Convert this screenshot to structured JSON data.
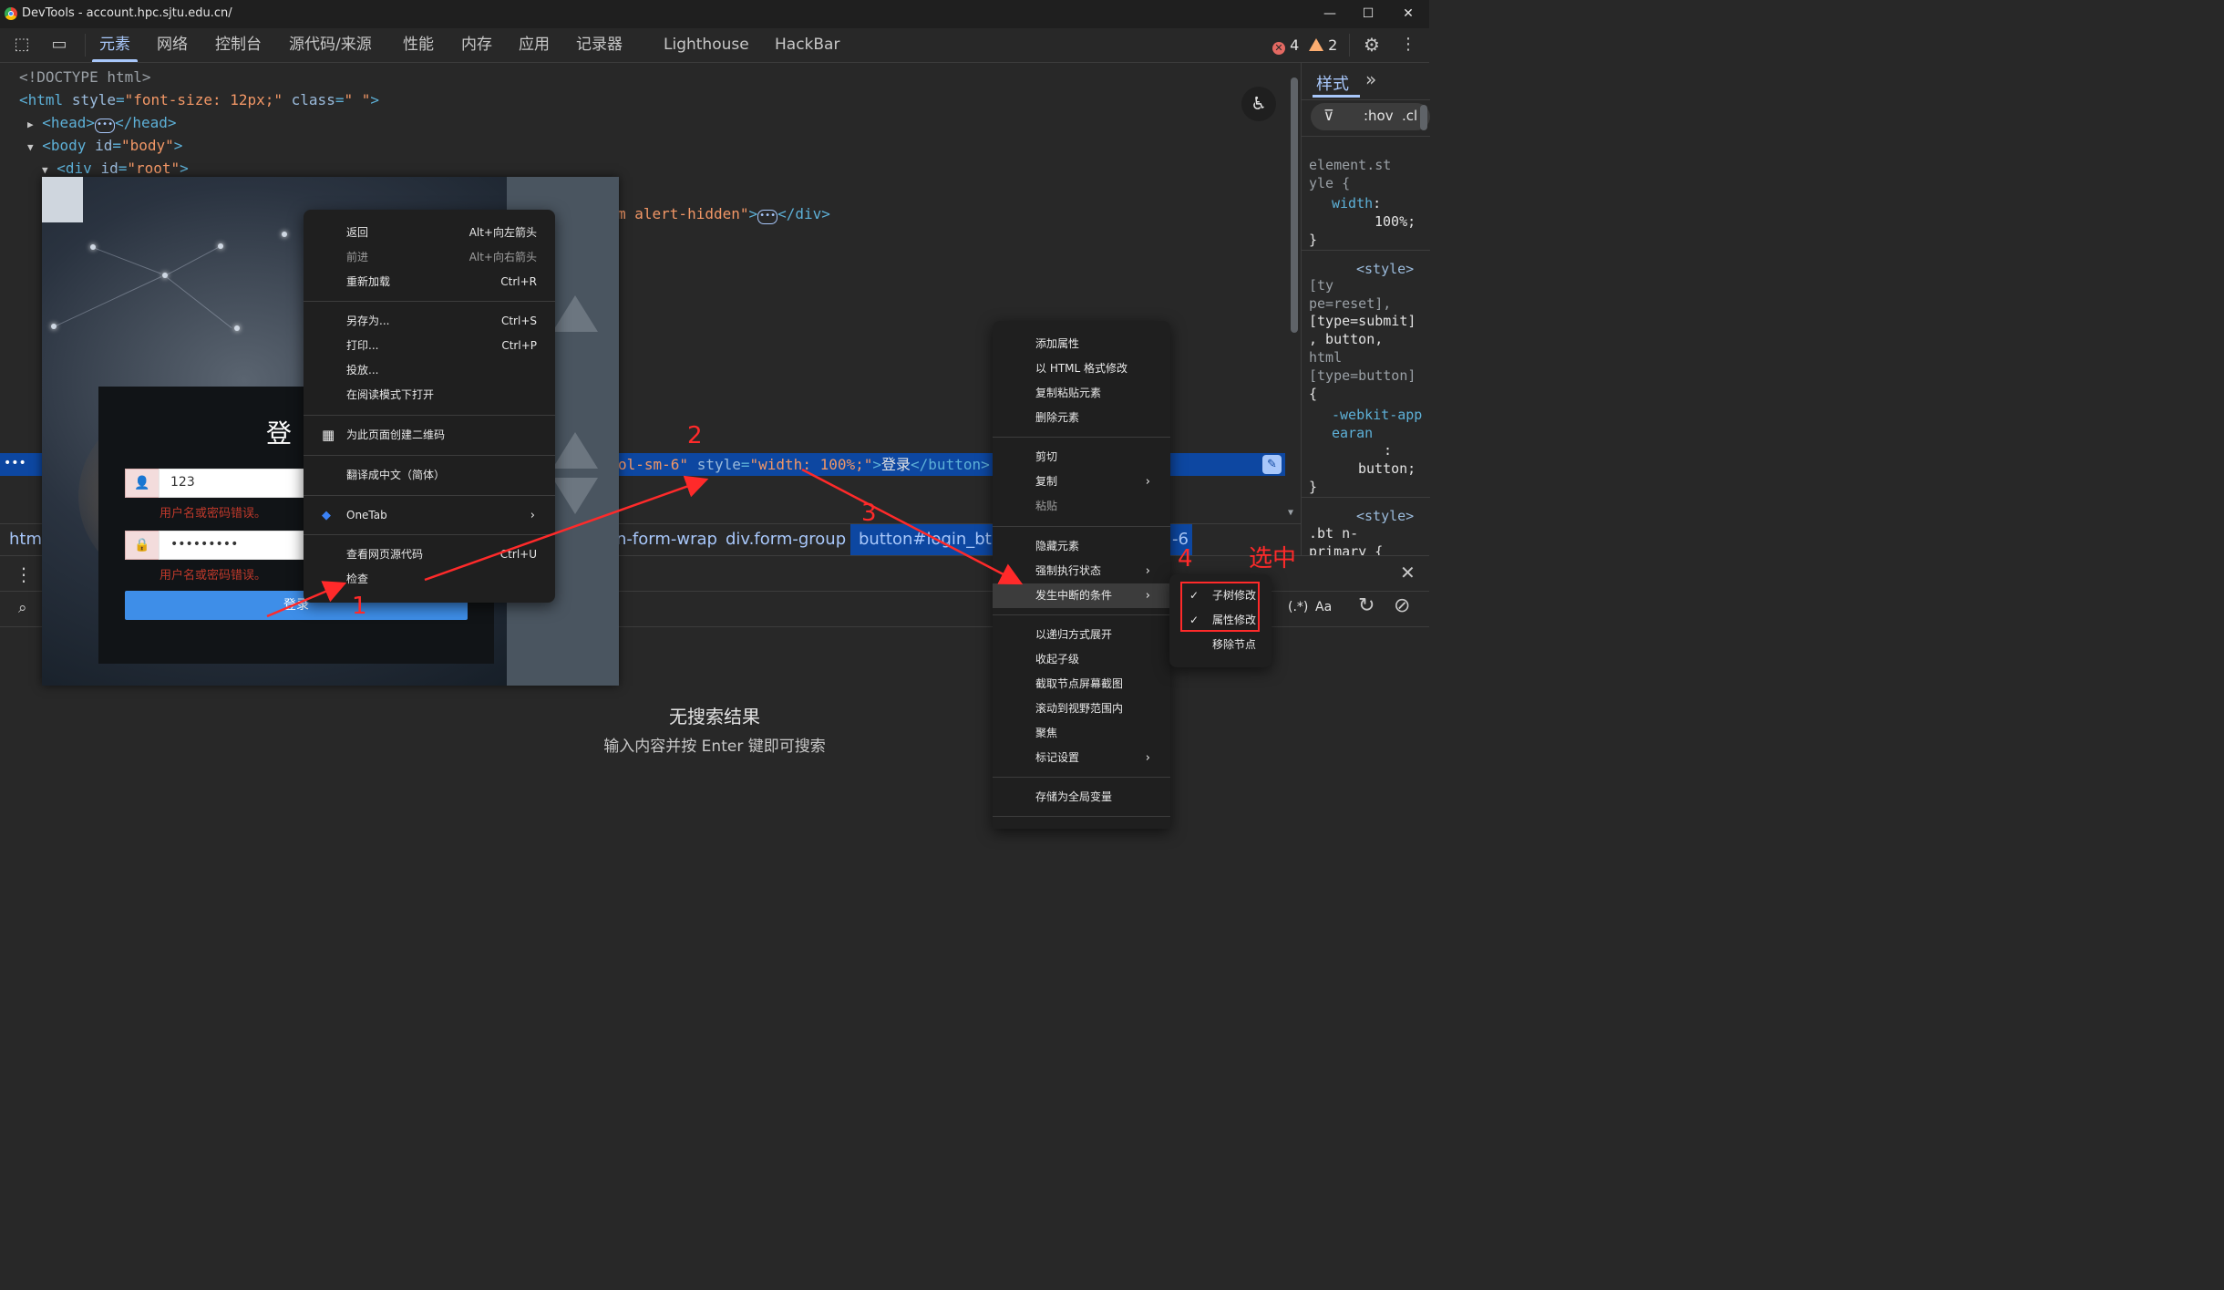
{
  "window": {
    "title": "DevTools - account.hpc.sjtu.edu.cn/"
  },
  "toolbar": {
    "tabs": [
      "元素",
      "网络",
      "控制台",
      "源代码/来源",
      "性能",
      "内存",
      "应用",
      "记录器",
      "Lighthouse",
      "HackBar"
    ],
    "active_tab": "元素",
    "error_count": "4",
    "warning_count": "2"
  },
  "dom": {
    "doctype": "<!DOCTYPE html>",
    "html_open_tag": "<html",
    "html_style_attr": "style",
    "html_style_val": "\"font-size: 12px;\"",
    "html_class_attr": "class",
    "html_class_val": "\" \"",
    "head_open": "<head>",
    "head_close": "</head>",
    "body_tag": "<body",
    "body_id_attr": "id",
    "body_id_val": "\"body\"",
    "div_tag": "<div",
    "div_id_attr": "id",
    "div_id_val": "\"root\"",
    "alert_fragment": "m alert-hidden\"",
    "div_close": "</div>",
    "selected_fragment_class": "ol-sm-6\"",
    "selected_style_attr": "style",
    "selected_style_val": "\"width: 100%;\"",
    "selected_text": "登录",
    "selected_close": "</button>",
    "selected_suffix": "== $"
  },
  "styles": {
    "tab_label": "样式",
    "filter_hov": ":hov",
    "filter_cls": ".cl",
    "rule1_selector": "element.st yle {",
    "rule1_prop": "width",
    "rule1_val": "100%;",
    "rule1_close": "}",
    "rule2_source": "<style>",
    "rule2_selector_a": "[ty pe=reset],",
    "rule2_selector_b": "[type=submit]",
    "rule2_selector_c": ", button,",
    "rule2_selector_d": "html",
    "rule2_selector_e": "[type=button]",
    "rule2_open": "{",
    "rule2_prop": "-webkit-appearan",
    "rule2_val": "button;",
    "rule2_close": "}",
    "rule3_source": "<style>",
    "rule3_selector": ".bt n-primary {"
  },
  "breadcrumb": {
    "items": [
      "html",
      "n-form-wrap",
      "div.form-group",
      "button#login_btn",
      "-6"
    ]
  },
  "search": {
    "regex_label": "(.*)",
    "case_label": "Aa",
    "no_results": "无搜索结果",
    "hint": "输入内容并按 Enter 键即可搜索"
  },
  "webpage": {
    "login_title_fragment": "登",
    "username_value": "123",
    "password_value": "•••••••••",
    "error_msg": "用户名或密码错误。",
    "login_button": "登录"
  },
  "page_menu": {
    "items": [
      {
        "label": "返回",
        "shortcut": "Alt+向左箭头"
      },
      {
        "label": "前进",
        "shortcut": "Alt+向右箭头"
      },
      {
        "label": "重新加载",
        "shortcut": "Ctrl+R"
      },
      {
        "label": "另存为...",
        "shortcut": "Ctrl+S"
      },
      {
        "label": "打印...",
        "shortcut": "Ctrl+P"
      },
      {
        "label": "投放...",
        "shortcut": ""
      },
      {
        "label": "在阅读模式下打开",
        "shortcut": ""
      },
      {
        "label": "为此页面创建二维码",
        "shortcut": ""
      },
      {
        "label": "翻译成中文（简体）",
        "shortcut": ""
      },
      {
        "label": "OneTab",
        "shortcut": ""
      },
      {
        "label": "查看网页源代码",
        "shortcut": "Ctrl+U"
      },
      {
        "label": "检查",
        "shortcut": ""
      }
    ]
  },
  "node_menu": {
    "items": [
      "添加属性",
      "以 HTML 格式修改",
      "复制粘贴元素",
      "删除元素",
      "剪切",
      "复制",
      "粘贴",
      "隐藏元素",
      "强制执行状态",
      "发生中断的条件",
      "以递归方式展开",
      "收起子级",
      "截取节点屏幕截图",
      "滚动到视野范围内",
      "聚焦",
      "标记设置",
      "存储为全局变量"
    ]
  },
  "break_submenu": {
    "items": [
      "子树修改",
      "属性修改",
      "移除节点"
    ],
    "checked": [
      "子树修改",
      "属性修改"
    ]
  },
  "annotations": {
    "steps": [
      "1",
      "2",
      "3",
      "4"
    ],
    "select_label": "选中",
    "color": "#ff2a2a"
  }
}
